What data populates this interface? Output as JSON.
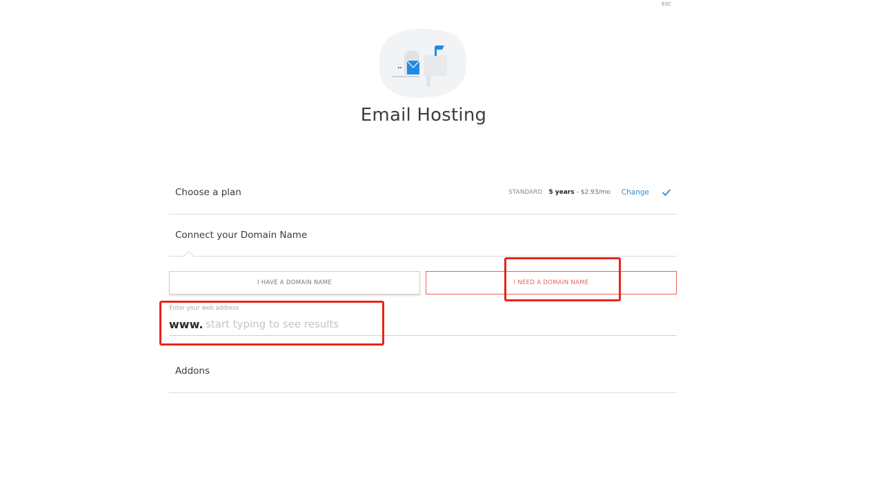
{
  "close": {
    "label": "ESC",
    "icon": "close-icon"
  },
  "header": {
    "title": "Email Hosting",
    "illustration": "mailbox-illustration"
  },
  "plan": {
    "label": "Choose a plan",
    "tier": "STANDARD",
    "term": "5 years",
    "price": "- $2.93/mo",
    "change_label": "Change",
    "status_icon": "checkmark-icon"
  },
  "domain": {
    "label": "Connect your Domain Name",
    "have_label": "I HAVE A DOMAIN NAME",
    "need_label": "I NEED A DOMAIN NAME",
    "web_address_label": "Enter your web address",
    "prefix": "www.",
    "placeholder": "start typing to see results",
    "value": ""
  },
  "addons": {
    "label": "Addons"
  },
  "colors": {
    "accent": "#2e8bd6",
    "selected": "#e9605c",
    "highlight": "#e8241a"
  }
}
